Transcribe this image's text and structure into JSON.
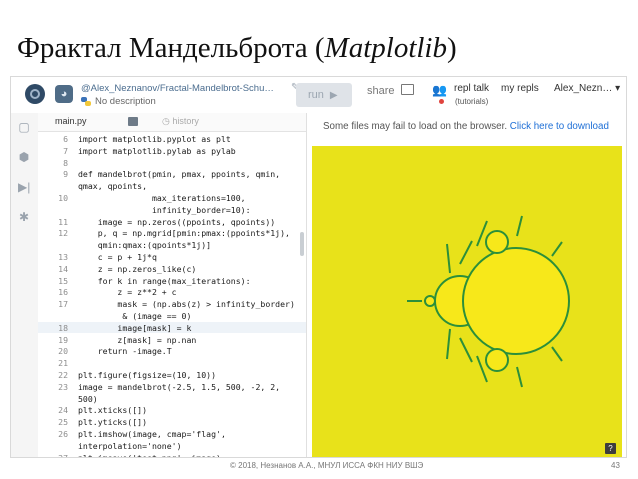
{
  "slide": {
    "title_main": "Фрактал Мандельброта  (",
    "title_italic": "Matplotlib",
    "title_end": ")",
    "footer": "© 2018, Незнанов А.А., МНУЛ ИССА ФКН НИУ ВШЭ",
    "page_number": "43"
  },
  "header": {
    "repl_name": "@Alex_Neznanov/Fractal-Mandelbrot-Schu…",
    "description": "No description",
    "run_label": "run",
    "share_label": "share",
    "repl_talk_label": "repl talk",
    "tutorials_label": "(tutorials)",
    "my_repls_label": "my repls",
    "user_label": "Alex_Nezn… ▾"
  },
  "tabs": {
    "file": "main.py",
    "history": "history"
  },
  "editor": {
    "highlight_line": "18",
    "lines": [
      {
        "n": "6",
        "t": "import matplotlib.pyplot as plt"
      },
      {
        "n": "7",
        "t": "import matplotlib.pylab as pylab"
      },
      {
        "n": "8",
        "t": ""
      },
      {
        "n": "9",
        "t": "def mandelbrot(pmin, pmax, ppoints, qmin,"
      },
      {
        "n": "",
        "t": "qmax, qpoints,"
      },
      {
        "n": "10",
        "t": "               max_iterations=100,"
      },
      {
        "n": "",
        "t": "               infinity_border=10):"
      },
      {
        "n": "11",
        "t": "    image = np.zeros((ppoints, qpoints))"
      },
      {
        "n": "12",
        "t": "    p, q = np.mgrid[pmin:pmax:(ppoints*1j),"
      },
      {
        "n": "",
        "t": "    qmin:qmax:(qpoints*1j)]"
      },
      {
        "n": "13",
        "t": "    c = p + 1j*q"
      },
      {
        "n": "14",
        "t": "    z = np.zeros_like(c)"
      },
      {
        "n": "15",
        "t": "    for k in range(max_iterations):"
      },
      {
        "n": "16",
        "t": "        z = z**2 + c"
      },
      {
        "n": "17",
        "t": "        mask = (np.abs(z) > infinity_border)"
      },
      {
        "n": "",
        "t": "         & (image == 0)"
      },
      {
        "n": "18",
        "t": "        image[mask] = k"
      },
      {
        "n": "19",
        "t": "        z[mask] = np.nan"
      },
      {
        "n": "20",
        "t": "    return -image.T"
      },
      {
        "n": "21",
        "t": ""
      },
      {
        "n": "22",
        "t": "plt.figure(figsize=(10, 10))"
      },
      {
        "n": "23",
        "t": "image = mandelbrot(-2.5, 1.5, 500, -2, 2,"
      },
      {
        "n": "",
        "t": "500)"
      },
      {
        "n": "24",
        "t": "plt.xticks([])"
      },
      {
        "n": "25",
        "t": "plt.yticks([])"
      },
      {
        "n": "26",
        "t": "plt.imshow(image, cmap='flag',"
      },
      {
        "n": "",
        "t": "interpolation='none')"
      },
      {
        "n": "27",
        "t": "plt.imsave('test.png', image)"
      }
    ]
  },
  "output": {
    "notice_text": "Some files may fail to load on the browser. ",
    "notice_link": "Click here to download",
    "help_label": "?"
  },
  "colors": {
    "fractal_background": "#e8e21a",
    "fractal_body": "#f7e81a",
    "fractal_edge": "#2c8f3a",
    "link": "#1e6fd6"
  },
  "icons": {
    "logo": "replit-logo",
    "python": "python-icon",
    "files": "files-icon",
    "packages": "packages-icon",
    "debugger": "debugger-icon",
    "settings": "gear-icon"
  }
}
